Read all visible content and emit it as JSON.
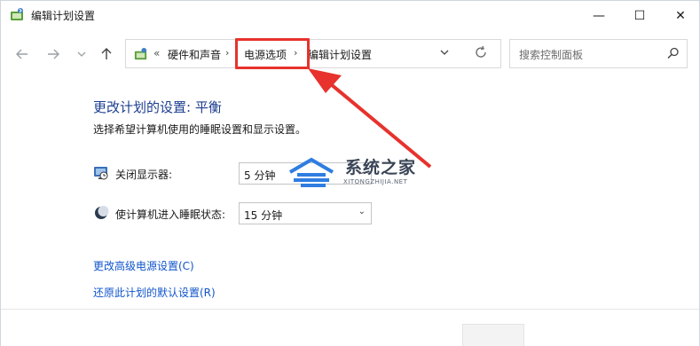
{
  "window": {
    "title": "编辑计划设置",
    "minimize_glyph": "—",
    "maximize_glyph": "☐",
    "close_glyph": "✕"
  },
  "nav": {
    "back_icon": "back-arrow-icon",
    "forward_icon": "forward-arrow-icon",
    "recent_icon": "chevron-down-icon",
    "up_icon": "up-arrow-icon"
  },
  "address": {
    "overflow": "«",
    "crumbs": [
      "硬件和声音",
      "电源选项",
      "编辑计划设置"
    ],
    "separator": "›",
    "dropdown": "⌄",
    "refresh": "↻"
  },
  "search": {
    "placeholder": "搜索控制面板"
  },
  "content": {
    "heading": "更改计划的设置: 平衡",
    "subtext": "选择希望计算机使用的睡眠设置和显示设置。",
    "rows": [
      {
        "label": "关闭显示器:",
        "value": "5 分钟"
      },
      {
        "label": "使计算机进入睡眠状态:",
        "value": "15 分钟"
      }
    ],
    "links": [
      "更改高级电源设置(C)",
      "还原此计划的默认设置(R)"
    ]
  },
  "watermark": {
    "title": "系统之家",
    "subtitle": "XITONGZHIJIA.NET"
  },
  "colors": {
    "heading": "#1b3d8f",
    "link": "#1155cc",
    "annotation": "#e7322d",
    "watermark_blue": "#2f7de1"
  }
}
